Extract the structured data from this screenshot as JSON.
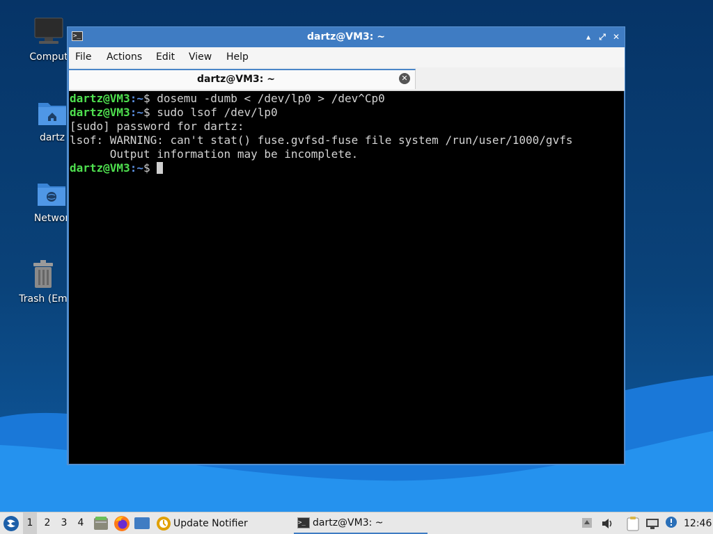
{
  "desktop": {
    "icons": [
      {
        "label": "Comput",
        "icon": "computer-icon"
      },
      {
        "label": "dartz",
        "icon": "home-folder-icon"
      },
      {
        "label": "Networ",
        "icon": "network-folder-icon"
      },
      {
        "label": "Trash (Em",
        "icon": "trash-icon"
      }
    ]
  },
  "window": {
    "title": "dartz@VM3: ~",
    "menu": [
      "File",
      "Actions",
      "Edit",
      "View",
      "Help"
    ],
    "tab_label": "dartz@VM3: ~",
    "controls": {
      "minimize": "▴",
      "maximize": "⤢",
      "close": "✕"
    }
  },
  "terminal": {
    "prompt_user": "dartz@VM3",
    "prompt_path": ":~",
    "prompt_sign": "$ ",
    "lines": [
      {
        "prompt": true,
        "text": "dosemu -dumb < /dev/lp0 > /dev^Cp0"
      },
      {
        "prompt": true,
        "text": "sudo lsof /dev/lp0"
      },
      {
        "prompt": false,
        "text": "[sudo] password for dartz:"
      },
      {
        "prompt": false,
        "text": "lsof: WARNING: can't stat() fuse.gvfsd-fuse file system /run/user/1000/gvfs"
      },
      {
        "prompt": false,
        "text": "      Output information may be incomplete."
      },
      {
        "prompt": true,
        "text": "",
        "cursor": true
      }
    ]
  },
  "taskbar": {
    "workspaces": [
      "1",
      "2",
      "3",
      "4"
    ],
    "active_workspace": "1",
    "tasks": [
      {
        "label": "Update Notifier",
        "icon": "update-notifier-icon"
      },
      {
        "label": "dartz@VM3: ~",
        "icon": "terminal-icon"
      }
    ],
    "clock": "12:46"
  }
}
